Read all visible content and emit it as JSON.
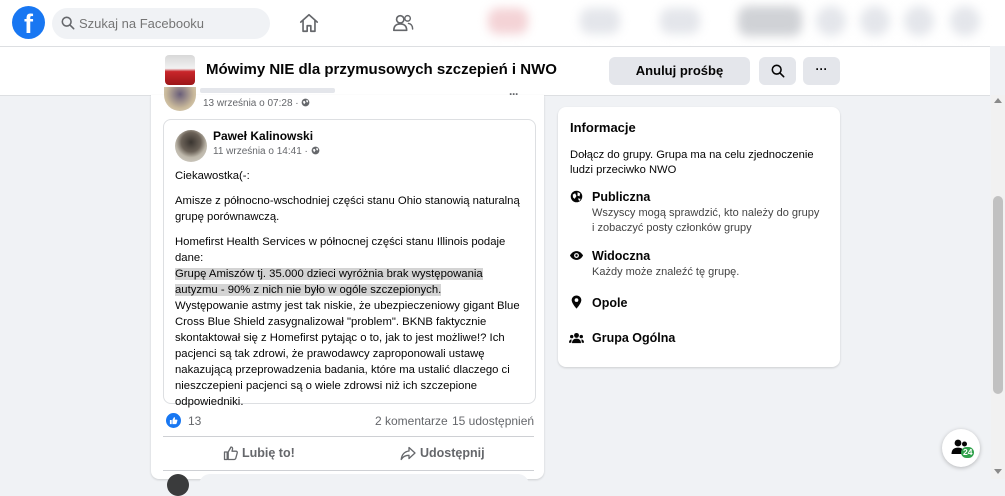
{
  "topnav": {
    "search_placeholder": "Szukaj na Facebooku",
    "logo_letter": "f"
  },
  "group": {
    "name": "Mówimy NIE dla przymusowych szczepień i NWO",
    "cancel_request_label": "Anuluj prośbę",
    "more_label": "···"
  },
  "post": {
    "time": "13 września o 07:28 ·",
    "more_label": "···",
    "shared": {
      "author": "Paweł Kalinowski",
      "time": "11 września o 14:41 ·",
      "paragraphs": {
        "p1": "Ciekawostka(-:",
        "p2": "Amisze z północno-wschodniej części stanu Ohio stanowią naturalną grupę porównawczą.",
        "p3a": "Homefirst Health Services w północnej części stanu Illinois podaje dane:",
        "p3b": " Grupę Amiszów tj. 35.000 dzieci wyróżnia brak występowania autyzmu - 90% z nich nie było w ogóle szczepionych.",
        "p3c": "Występowanie astmy jest tak niskie, że ubezpieczeniowy gigant Blue Cross Blue Shield zasygnalizował \"problem\". BKNB faktycznie skontaktował się z Homefirst pytając o to, jak to jest możliwe!? Ich pacjenci są tak zdrowi, że prawodawcy zaproponowali ustawę nakazującą przeprowadzenia badania, które ma ustalić dlaczego ci nieszczepieni pacjenci są o wiele zdrowsi niż ich szczepione odpowiedniki."
      }
    },
    "reactions_count": "13",
    "comments_count": "2 komentarze",
    "shares_count": "15 udostępnień",
    "like_label": "Lubię to!",
    "share_label": "Udostępnij"
  },
  "info": {
    "title": "Informacje",
    "description": "Dołącz do grupy. Grupa ma na celu zjednoczenie ludzi przeciwko NWO",
    "items": [
      {
        "icon": "globe-icon",
        "title": "Publiczna",
        "sub": "Wszyscy mogą sprawdzić, kto należy do grupy i zobaczyć posty członków grupy"
      },
      {
        "icon": "eye-icon",
        "title": "Widoczna",
        "sub": "Każdy może znaleźć tę grupę."
      },
      {
        "icon": "location-pin-icon",
        "title": "Opole",
        "sub": ""
      },
      {
        "icon": "people-icon",
        "title": "Grupa Ogólna",
        "sub": ""
      }
    ]
  },
  "chat": {
    "badge": "24"
  },
  "colors": {
    "brand": "#1877f2",
    "background": "#f0f2f5",
    "button_grey": "#e4e6eb",
    "highlight": "#d4d4d4"
  }
}
